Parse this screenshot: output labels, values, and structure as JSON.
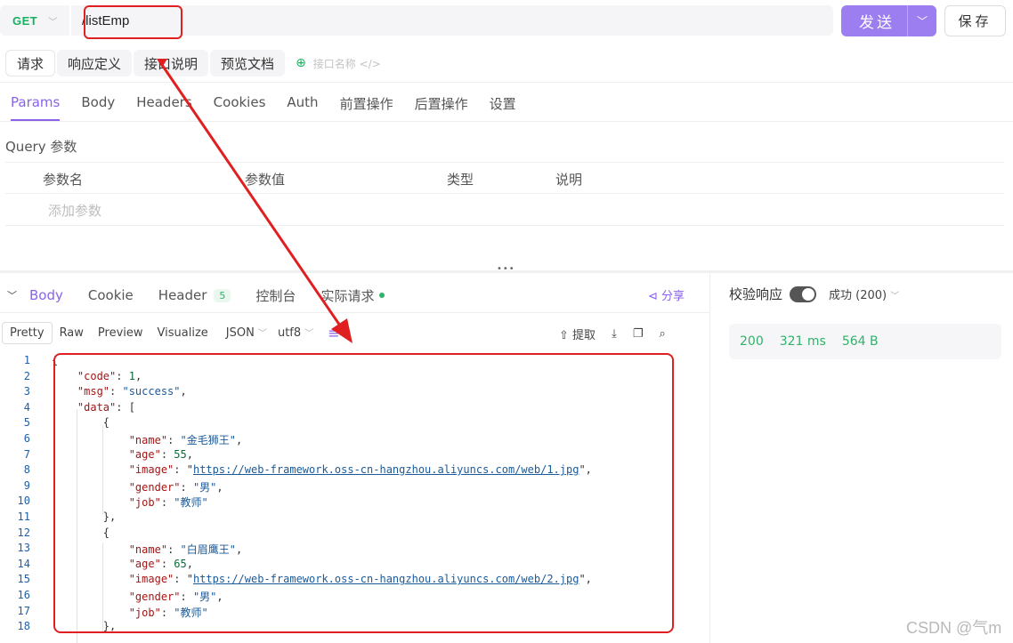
{
  "request": {
    "method": "GET",
    "url": "/listEmp",
    "send_label": "发送",
    "save_label": "保存"
  },
  "subtabs": [
    "请求",
    "响应定义",
    "接口说明",
    "预览文档"
  ],
  "api_name_placeholder": "接口名称 </>",
  "param_tabs": [
    "Params",
    "Body",
    "Headers",
    "Cookies",
    "Auth",
    "前置操作",
    "后置操作",
    "设置"
  ],
  "query": {
    "title": "Query 参数",
    "headers": [
      "参数名",
      "参数值",
      "类型",
      "说明"
    ],
    "add_label": "添加参数"
  },
  "response_tabs": {
    "body": "Body",
    "cookie": "Cookie",
    "header": "Header",
    "header_count": "5",
    "console": "控制台",
    "actual": "实际请求",
    "share": "分享"
  },
  "format_options": [
    "Pretty",
    "Raw",
    "Preview",
    "Visualize"
  ],
  "format_select": "JSON",
  "encoding_select": "utf8",
  "tools": {
    "extract": "提取"
  },
  "verify": {
    "label": "校验响应",
    "status": "成功 (200)"
  },
  "stats": {
    "code": "200",
    "time": "321 ms",
    "size": "564 B"
  },
  "code_lines": [
    "{",
    "    \"code\": 1,",
    "    \"msg\": \"success\",",
    "    \"data\": [",
    "        {",
    "            \"name\": \"金毛狮王\",",
    "            \"age\": 55,",
    "            \"image\": \"https://web-framework.oss-cn-hangzhou.aliyuncs.com/web/1.jpg\",",
    "            \"gender\": \"男\",",
    "            \"job\": \"教师\"",
    "        },",
    "        {",
    "            \"name\": \"白眉鹰王\",",
    "            \"age\": 65,",
    "            \"image\": \"https://web-framework.oss-cn-hangzhou.aliyuncs.com/web/2.jpg\",",
    "            \"gender\": \"男\",",
    "            \"job\": \"教师\"",
    "        },"
  ],
  "watermark": "CSDN @气m"
}
